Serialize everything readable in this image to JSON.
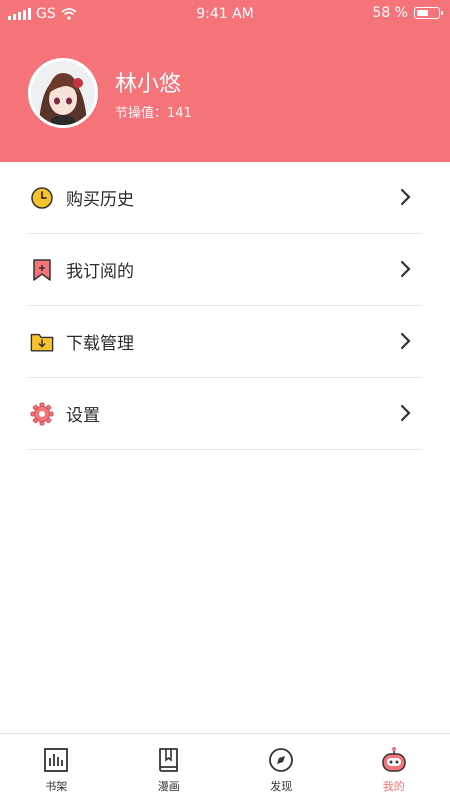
{
  "status_bar": {
    "carrier": "GS",
    "time": "9:41 AM",
    "battery": "58 %",
    "battery_level": 0.58
  },
  "profile": {
    "username": "林小悠",
    "points": "节操值：141"
  },
  "menu": {
    "items": [
      {
        "label": "购买历史",
        "icon": "clock-icon"
      },
      {
        "label": "我订阅的",
        "icon": "bookmark-icon"
      },
      {
        "label": "下载管理",
        "icon": "download-folder-icon"
      },
      {
        "label": "设置",
        "icon": "gear-icon"
      }
    ]
  },
  "tabbar": {
    "tabs": [
      {
        "label": "书架",
        "icon": "bookshelf-icon"
      },
      {
        "label": "漫画",
        "icon": "comic-book-icon"
      },
      {
        "label": "发现",
        "icon": "compass-icon"
      },
      {
        "label": "我的",
        "icon": "robot-icon",
        "active": true
      }
    ]
  },
  "colors": {
    "accent": "#f47479",
    "divider": "#e8e8e8"
  }
}
